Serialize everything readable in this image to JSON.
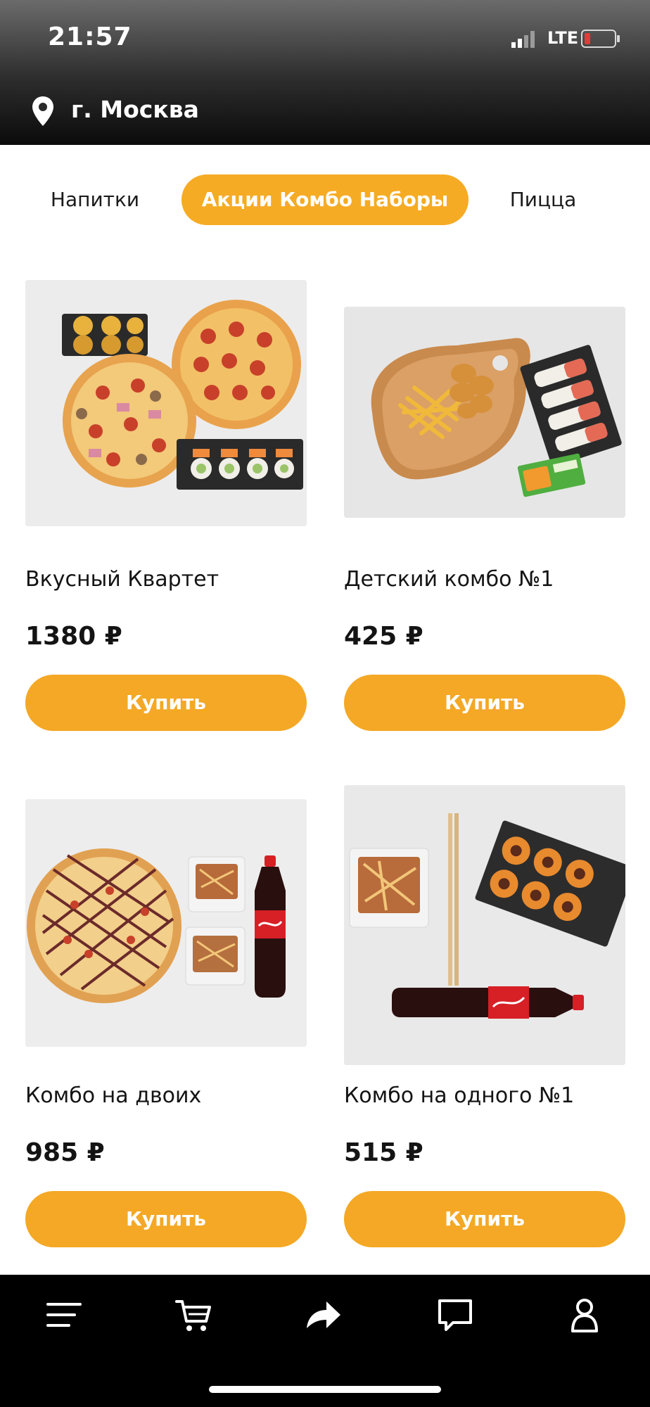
{
  "status_bar": {
    "time": "21:57",
    "network": "LTE",
    "signal_icon": "signal-bars-icon",
    "battery_icon": "battery-low-icon"
  },
  "location": {
    "icon": "location-pin-icon",
    "city": "г. Москва"
  },
  "tabs": [
    {
      "label": "Напитки",
      "active": false
    },
    {
      "label": "Акции Комбо Наборы",
      "active": true
    },
    {
      "label": "Пицца",
      "active": false
    }
  ],
  "products": [
    {
      "name": "Вкусный Квартет",
      "price": "1380 ₽",
      "buy_label": "Купить"
    },
    {
      "name": "Детский комбо №1",
      "price": "425 ₽",
      "buy_label": "Купить"
    },
    {
      "name": "Комбо на двоих",
      "price": "985 ₽",
      "buy_label": "Купить"
    },
    {
      "name": "Комбо на одного №1",
      "price": "515 ₽",
      "buy_label": "Купить"
    }
  ],
  "bottom_nav": [
    {
      "icon": "menu-icon"
    },
    {
      "icon": "cart-icon"
    },
    {
      "icon": "share-icon"
    },
    {
      "icon": "chat-icon"
    },
    {
      "icon": "profile-icon"
    }
  ],
  "colors": {
    "accent": "#f4a825",
    "header_dark": "#0b0b0b",
    "bottom_bar": "#000000"
  }
}
